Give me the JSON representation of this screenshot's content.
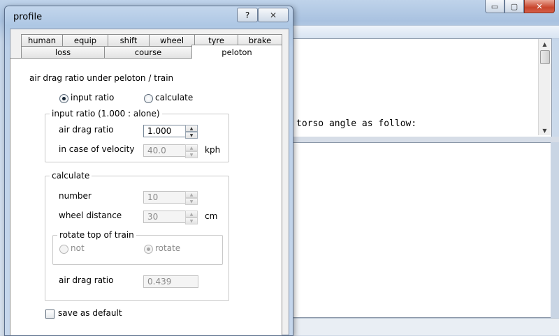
{
  "main_window": {
    "caption_buttons": {
      "minimize": "▭",
      "maximize": "▢",
      "close": "✕"
    },
    "text_line": "torso angle as follow:",
    "scrollbar": {
      "up_arrow": "▲",
      "down_arrow": "▼"
    }
  },
  "dialog": {
    "title": "profile",
    "help_button": "?",
    "close_button": "✕",
    "tabs_row1": [
      "human",
      "equip",
      "shift",
      "wheel",
      "tyre",
      "brake"
    ],
    "tabs_row2": [
      "loss",
      "course",
      "peloton"
    ],
    "active_tab": "peloton",
    "peloton": {
      "section_title": "air drag ratio under peloton / train",
      "mode_options": {
        "input": "input ratio",
        "calculate": "calculate"
      },
      "selected_mode": "input ratio",
      "input_group": {
        "title": "input ratio (1.000 : alone)",
        "air_drag_label": "air drag ratio",
        "air_drag_value": "1.000",
        "velocity_label": "in case of velocity",
        "velocity_value": "40.0",
        "velocity_unit": "kph"
      },
      "calculate_group": {
        "title": "calculate",
        "number_label": "number",
        "number_value": "10",
        "distance_label": "wheel distance",
        "distance_value": "30",
        "distance_unit": "cm",
        "rotate_group": {
          "title": "rotate top of train",
          "not_label": "not",
          "rotate_label": "rotate",
          "selected": "rotate"
        },
        "result_label": "air drag ratio",
        "result_value": "0.439"
      },
      "save_default_label": "save as default",
      "save_default_checked": false
    }
  },
  "spinner_arrows": {
    "up": "▲",
    "down": "▼"
  },
  "colors": {
    "window_frame": "#aec7e4",
    "close_red": "#c8452c",
    "disabled_text": "#8a8a8a"
  }
}
